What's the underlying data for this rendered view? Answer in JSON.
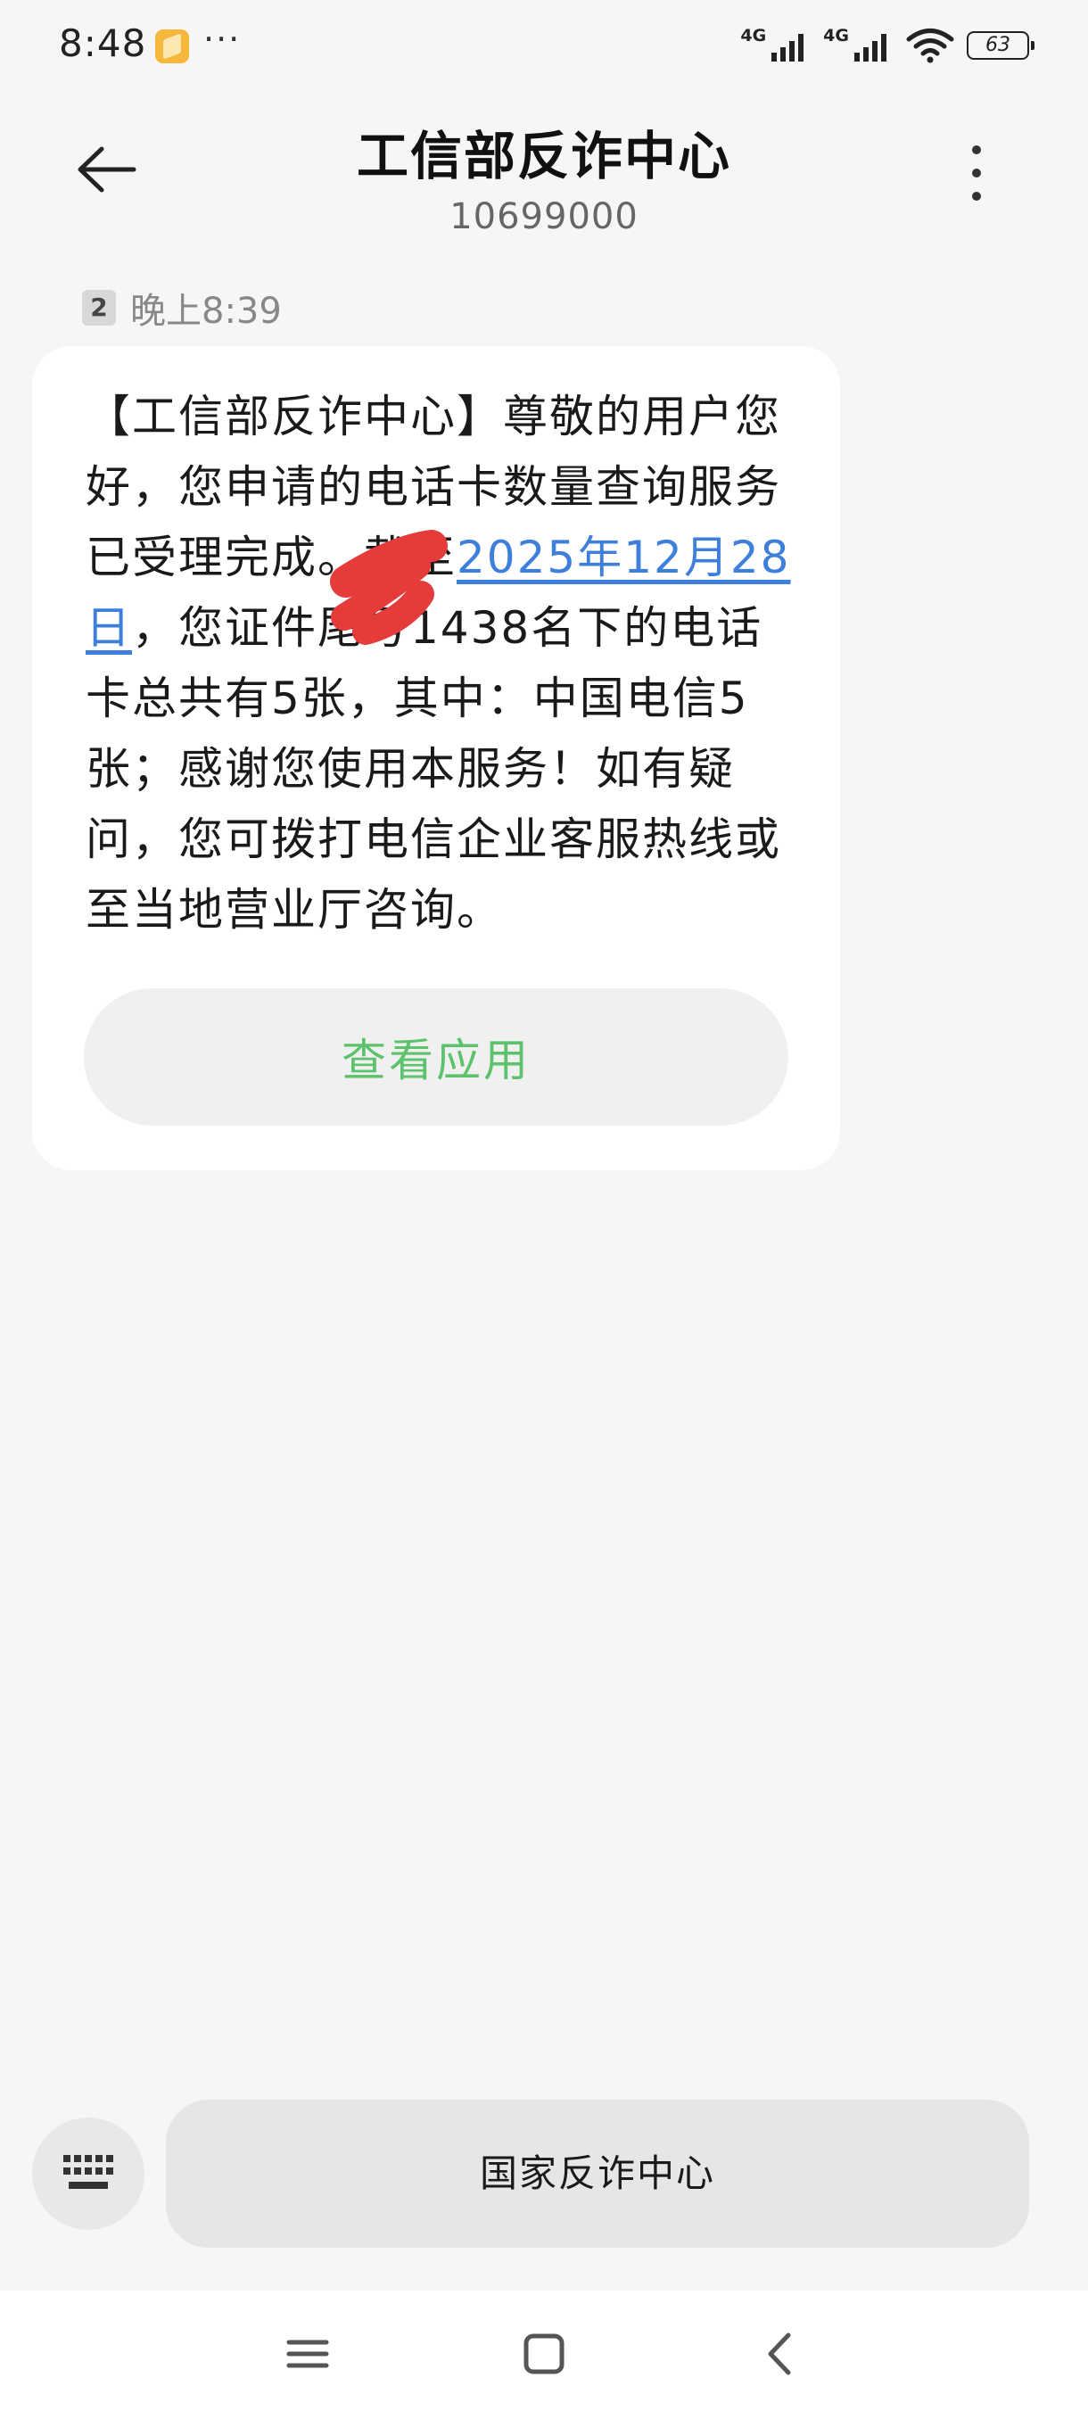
{
  "status_bar": {
    "time": "8:48",
    "overflow": "···",
    "network1": "4G",
    "network2": "4G",
    "battery": "63"
  },
  "header": {
    "title": "工信部反诈中心",
    "subtitle": "10699000"
  },
  "message": {
    "sim": "2",
    "time": "晚上8:39",
    "text_part1": "【工信部反诈中心】尊敬的用户您好，您申请的电话卡数量查询服务已受理完成。截至",
    "link_text": "2025年12月28日",
    "text_part2": "，您证件尾号1438名下的电话卡总共有5张，其中：中国电信5张；感谢您使用本服务！如有疑问，您可拨打电信企业客服热线或至当地营业厅咨询。",
    "action_label": "查看应用"
  },
  "input": {
    "quick_reply": "国家反诈中心"
  },
  "colors": {
    "link": "#3f7fdc",
    "action": "#5cc26c",
    "redaction": "#e53b3b"
  },
  "icons": {
    "back": "arrow-left-icon",
    "more": "more-vertical-icon",
    "keyboard": "keyboard-icon",
    "nav_menu": "menu-icon",
    "nav_home": "home-square-icon",
    "nav_back": "chevron-left-icon"
  }
}
